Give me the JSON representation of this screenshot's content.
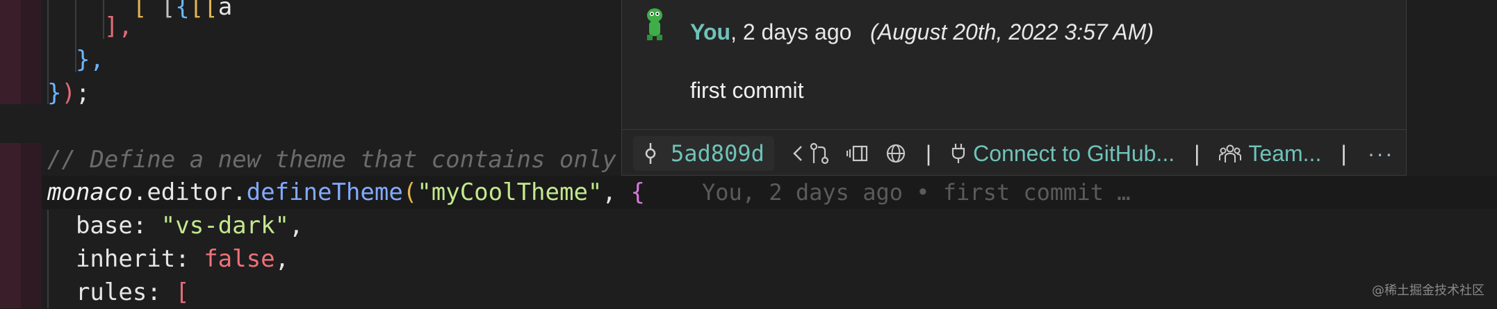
{
  "editor": {
    "lines": [
      {
        "id": "l0",
        "text_a": "      ",
        "text_b": "[",
        "tail": " , ",
        "rest": "[[...                     ] ...]);  ...        ..."
      },
      {
        "id": "l1",
        "close": "],",
        "indent": "    "
      },
      {
        "id": "l2",
        "close": "},",
        "indent": "  "
      },
      {
        "id": "l3",
        "close_a": "}",
        "close_b": ")",
        "close_c": ";"
      },
      {
        "id": "l5",
        "comment": "// Define a new theme that contains only r"
      },
      {
        "id": "l6",
        "obj": "monaco",
        "dot1": ".",
        "prop": "editor",
        "dot2": ".",
        "fn": "defineTheme",
        "open": "(",
        "str": "\"myCoolTheme\"",
        "comma": ", ",
        "brace": "{"
      },
      {
        "id": "l7",
        "key": "base",
        "colon": ": ",
        "str": "\"vs-dark\"",
        "comma": ","
      },
      {
        "id": "l8",
        "key": "inherit",
        "colon": ": ",
        "kw": "false",
        "comma": ","
      },
      {
        "id": "l9",
        "key": "rules",
        "colon": ": ",
        "bracket": "["
      }
    ],
    "inline_blame": "You, 2 days ago • first commit …"
  },
  "hover": {
    "author": "You",
    "relative": ", 2 days ago",
    "date": "(August 20th, 2022 3:57 AM)",
    "message": "first commit",
    "sha": "5ad809d",
    "connect_label": "Connect to GitHub...",
    "team_label": "Team...",
    "more_label": "···",
    "separator": "|"
  },
  "colors": {
    "accent": "#6fc3b9",
    "background": "#1e1e1f"
  },
  "icons": [
    "commit-icon",
    "previous-icon",
    "compare-icon",
    "open-changes-icon",
    "web-icon",
    "plug-icon",
    "team-icon",
    "more-icon"
  ],
  "watermark": "@稀土掘金技术社区"
}
